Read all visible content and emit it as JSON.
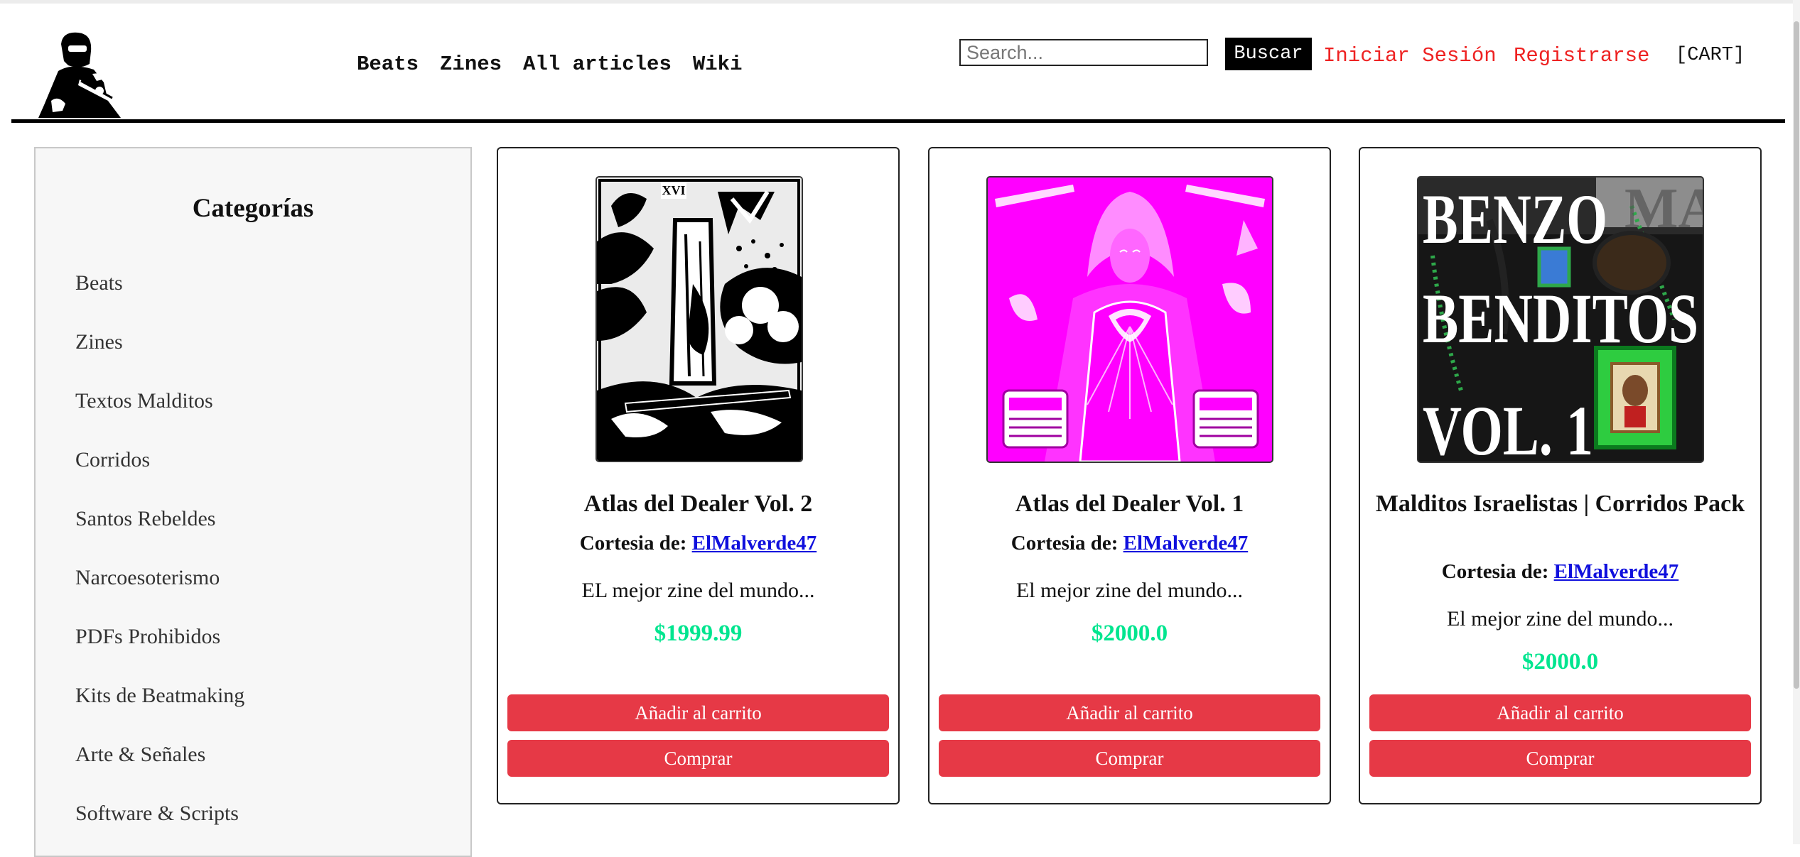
{
  "header": {
    "nav": [
      "Beats",
      "Zines",
      "All articles",
      "Wiki"
    ],
    "search": {
      "placeholder": "Search...",
      "button_label": "Buscar"
    },
    "login_label": "Iniciar Sesión",
    "register_label": "Registrarse",
    "cart_label": "[CART]"
  },
  "sidebar": {
    "title": "Categorías",
    "items": [
      "Beats",
      "Zines",
      "Textos Malditos",
      "Corridos",
      "Santos Rebeldes",
      "Narcoesoterismo",
      "PDFs Prohibidos",
      "Kits de Beatmaking",
      "Arte & Señales",
      "Software & Scripts"
    ]
  },
  "products": [
    {
      "title": "Atlas del Dealer Vol. 2",
      "seller_prefix": "Cortesia de:",
      "seller": "ElMalverde47",
      "description": "EL mejor zine del mundo...",
      "price": "$1999.99",
      "add_label": "Añadir al carrito",
      "buy_label": "Comprar"
    },
    {
      "title": "Atlas del Dealer Vol. 1",
      "seller_prefix": "Cortesia de:",
      "seller": "ElMalverde47",
      "description": "El mejor zine del mundo...",
      "price": "$2000.0",
      "add_label": "Añadir al carrito",
      "buy_label": "Comprar"
    },
    {
      "title": "Malditos Israelistas | Corridos Pack",
      "seller_prefix": "Cortesia de:",
      "seller": "ElMalverde47",
      "description": "El mejor zine del mundo...",
      "price": "$2000.0",
      "add_label": "Añadir al carrito",
      "buy_label": "Comprar",
      "cover_text": [
        "BENZO",
        "BENDITOS",
        "VOL. 1"
      ]
    }
  ],
  "colors": {
    "accent_button": "#e63946",
    "price": "#00e58f",
    "auth_links": "#ee2222",
    "seller_link": "#1010dd",
    "zine_magenta": "#ff00ff"
  },
  "icons": {
    "logo": "masked-figure-logo",
    "cover_1": "tarot-tower-card-image",
    "cover_2": "magenta-virgin-image",
    "cover_3": "benzo-benditos-cover-image"
  }
}
